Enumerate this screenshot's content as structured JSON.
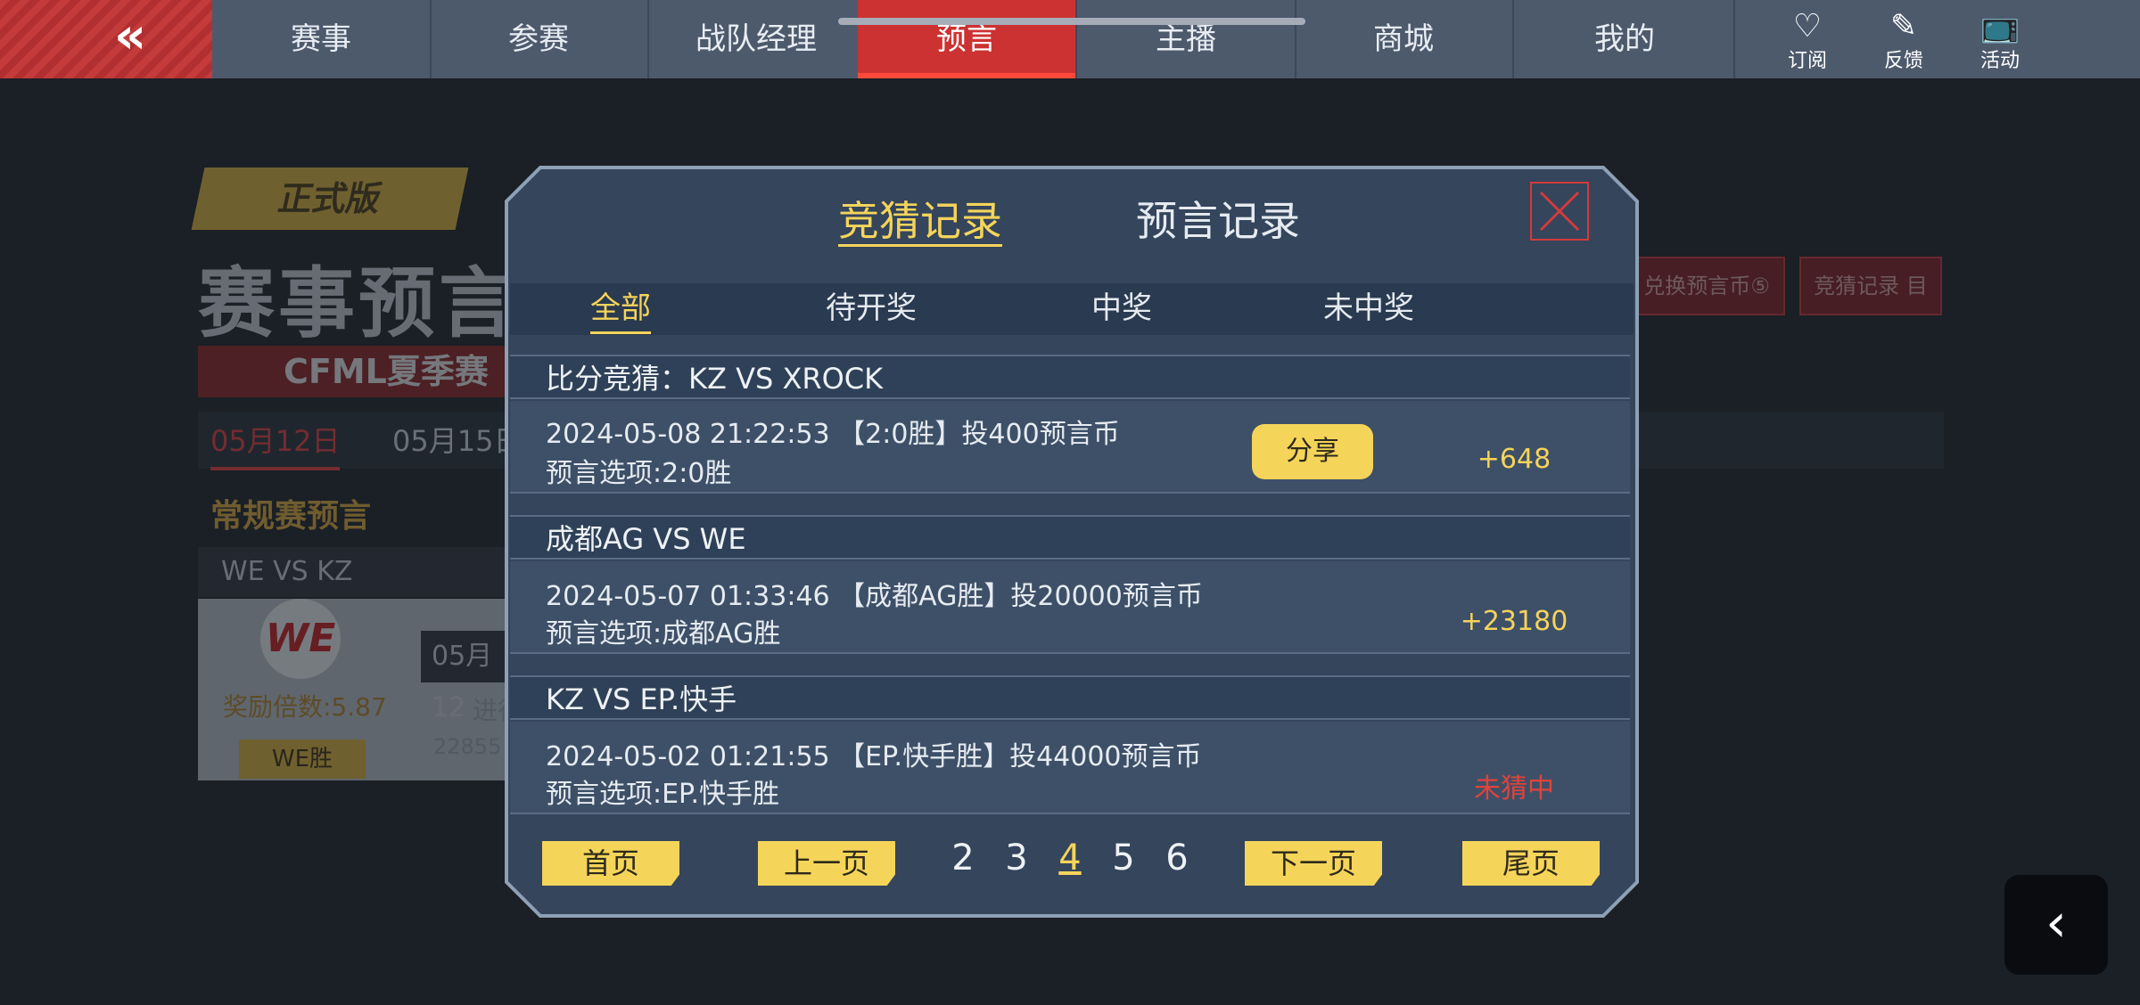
{
  "nav": {
    "back_icon": "«",
    "tabs": [
      "赛事",
      "参赛",
      "战队经理",
      "预言",
      "主播",
      "商城",
      "我的"
    ],
    "active_tab": "预言",
    "icons": [
      {
        "glyph": "♡",
        "label": "订阅"
      },
      {
        "glyph": "✎",
        "label": "反馈"
      },
      {
        "glyph": "📺",
        "label": "活动"
      }
    ]
  },
  "background": {
    "version_badge": "正式版",
    "title": "赛事预言",
    "season": "CFML夏季赛",
    "dates": [
      "05月12日",
      "05月15日"
    ],
    "section_title": "常规赛预言",
    "match": "WE VS KZ",
    "team_logo_text": "WE",
    "odds": "奖励倍数:5.87",
    "team_win_button": "WE胜",
    "mini_date": "05月12",
    "mini_status": "进行",
    "mini_count": "22855",
    "right_buttons": [
      "兑换预言币⑤",
      "竞猜记录 目"
    ],
    "floating_back_icon": "‹"
  },
  "modal": {
    "tabs": {
      "quiz": "竞猜记录",
      "prediction": "预言记录"
    },
    "filters": [
      "全部",
      "待开奖",
      "中奖",
      "未中奖"
    ],
    "active_filter": "全部",
    "records": [
      {
        "title": "比分竞猜：KZ VS XROCK",
        "line1": "2024-05-08 21:22:53 【2:0胜】投400预言币",
        "line2": "预言选项:2:0胜",
        "result": "+648",
        "result_color": "#f5d45a",
        "share_label": "分享"
      },
      {
        "title": "成都AG VS WE",
        "line1": "2024-05-07 01:33:46 【成都AG胜】投20000预言币",
        "line2": "预言选项:成都AG胜",
        "result": "+23180",
        "result_color": "#f5d45a"
      },
      {
        "title": "KZ VS EP.快手",
        "line1": "2024-05-02 01:21:55 【EP.快手胜】投44000预言币",
        "line2": "预言选项:EP.快手胜",
        "result": "未猜中",
        "result_color": "#e0433b"
      }
    ],
    "pagination": {
      "first": "首页",
      "prev": "上一页",
      "pages": [
        "2",
        "3",
        "4",
        "5",
        "6"
      ],
      "current": "4",
      "next": "下一页",
      "last": "尾页"
    }
  }
}
